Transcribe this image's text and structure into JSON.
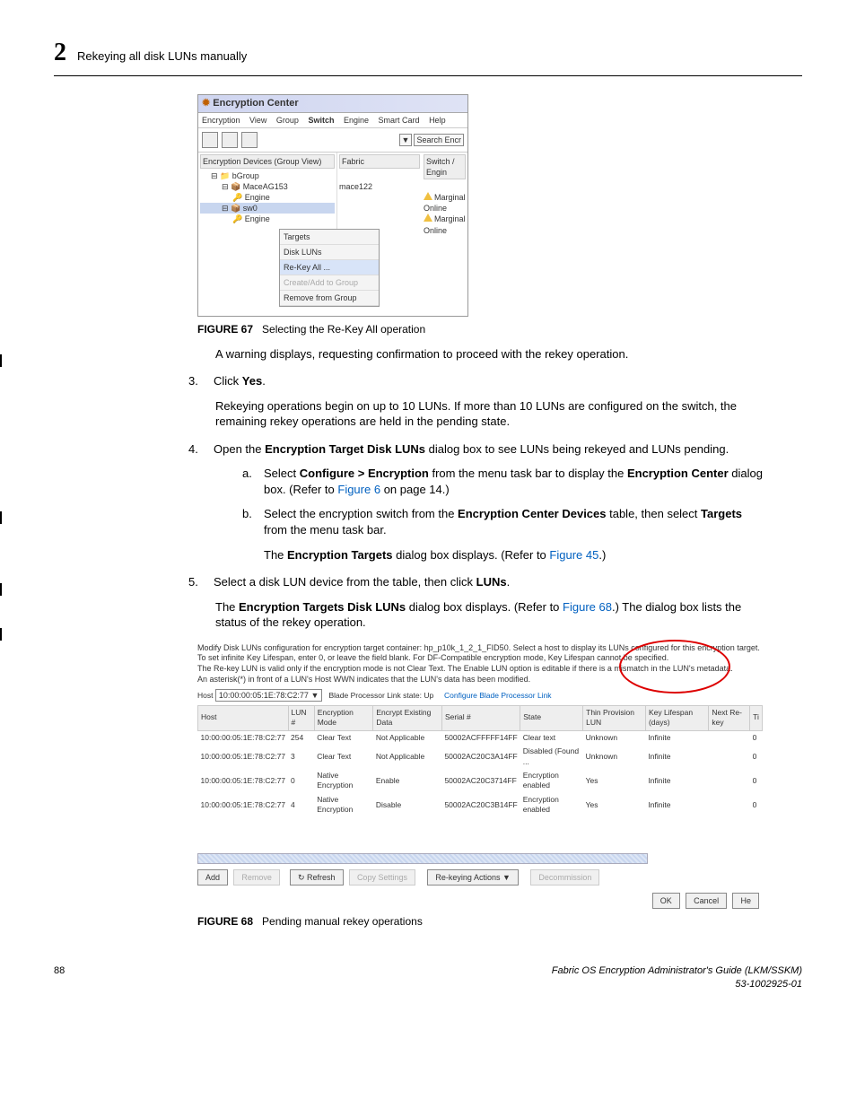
{
  "header": {
    "chapter_no": "2",
    "chapter_title": "Rekeying all disk LUNs manually"
  },
  "fig67": {
    "label": "FIGURE 67",
    "caption": "Selecting the Re-Key All operation",
    "window_title": "Encryption Center",
    "menus": [
      "Encryption",
      "View",
      "Group",
      "Switch",
      "Engine",
      "Smart Card",
      "Help"
    ],
    "search_placeholder": "Search Encr",
    "col1_head": "Encryption Devices (Group View)",
    "col2_head": "Fabric",
    "col3_head": "Switch / Engin",
    "tree": {
      "root": "bGroup",
      "n1": "MaceAG153",
      "n1_fab": "mace122",
      "n1_stat": "Marginal",
      "n1c": "Engine",
      "n1c_stat": "Online",
      "n2": "sw0",
      "n2_stat": "Marginal",
      "n2c": "Engine",
      "n2c_stat": "Online"
    },
    "ctx": [
      "Targets",
      "Disk LUNs",
      "Re-Key All ...",
      "Create/Add to Group",
      "Remove from Group"
    ]
  },
  "para_warning": "A warning displays, requesting confirmation to proceed with the rekey operation.",
  "step3": {
    "num": "3.",
    "pre": "Click ",
    "bold": "Yes",
    "post": "."
  },
  "para_rekey": "Rekeying operations begin on up to 10 LUNs. If more than 10 LUNs are configured on the switch, the remaining rekey operations are held in the pending state.",
  "step4": {
    "num": "4.",
    "pre": "Open the ",
    "bold": "Encryption Target Disk LUNs",
    "post": " dialog box to see LUNs being rekeyed and LUNs pending."
  },
  "sub_a": {
    "let": "a.",
    "p1": "Select ",
    "b1": "Configure > Encryption",
    "p2": " from the menu task bar to display the ",
    "b2": "Encryption Center",
    "p3": " dialog box. (Refer to ",
    "link": "Figure 6",
    "p4": " on page 14.)"
  },
  "sub_b": {
    "let": "b.",
    "p1": "Select the encryption switch from the ",
    "b1": "Encryption Center Devices",
    "p2": " table, then select ",
    "b2": "Targets",
    "p3": " from the menu task bar."
  },
  "para_targets": {
    "p1": "The ",
    "b1": "Encryption Targets",
    "p2": " dialog box displays. (Refer to ",
    "link": "Figure 45",
    "p3": ".)"
  },
  "step5": {
    "num": "5.",
    "p1": "Select a disk LUN device from the table, then click ",
    "b1": "LUNs",
    "p2": "."
  },
  "para_dlg": {
    "p1": "The ",
    "b1": "Encryption Targets Disk LUNs",
    "p2": " dialog box displays. (Refer to ",
    "link": "Figure 68",
    "p3": ".) The dialog box lists the status of the rekey operation."
  },
  "fig68": {
    "label": "FIGURE 68",
    "caption": "Pending manual rekey operations",
    "desc1": "Modify Disk LUNs configuration for encryption target container: hp_p10k_1_2_1_FID50. Select a host to display its LUNs configured for this encryption target.",
    "desc2": "To set infinite Key Lifespan, enter 0, or leave the field blank. For DF-Compatible encryption mode, Key Lifespan cannot be specified.",
    "desc3": "The Re-key LUN is valid only if the encryption mode is not Clear Text. The Enable LUN option is editable if there is a mismatch in the LUN's metadata.",
    "desc4": "An asterisk(*) in front of a LUN's Host WWN indicates that the LUN's data has been modified.",
    "host_label": "Host",
    "host_value": "10:00:00:05:1E:78:C2:77",
    "bpl_label": "Blade Processor Link state:",
    "bpl_value": "Up",
    "bpl_link": "Configure Blade Processor Link",
    "cols": [
      "Host",
      "LUN #",
      "Encryption Mode",
      "Encrypt Existing Data",
      "Serial #",
      "State",
      "Thin Provision LUN",
      "Key Lifespan (days)",
      "Next Re-key",
      "Ti"
    ],
    "rows": [
      [
        "10:00:00:05:1E:78:C2:77",
        "254",
        "Clear Text",
        "Not Applicable",
        "50002ACFFFFF14FF",
        "Clear text",
        "Unknown",
        "Infinite",
        "",
        "0"
      ],
      [
        "10:00:00:05:1E:78:C2:77",
        "3",
        "Clear Text",
        "Not Applicable",
        "50002AC20C3A14FF",
        "Disabled (Found ...",
        "Unknown",
        "Infinite",
        "",
        "0"
      ],
      [
        "10:00:00:05:1E:78:C2:77",
        "0",
        "Native Encryption",
        "Enable",
        "50002AC20C3714FF",
        "Encryption enabled",
        "Yes",
        "Infinite",
        "",
        "0"
      ],
      [
        "10:00:00:05:1E:78:C2:77",
        "4",
        "Native Encryption",
        "Disable",
        "50002AC20C3B14FF",
        "Encryption enabled",
        "Yes",
        "Infinite",
        "",
        "0"
      ]
    ],
    "btns": {
      "add": "Add",
      "remove": "Remove",
      "refresh": "Refresh",
      "copy": "Copy Settings",
      "rekey": "Re-keying Actions ▼",
      "decom": "Decommission",
      "ok": "OK",
      "cancel": "Cancel",
      "help": "He"
    }
  },
  "footer": {
    "page": "88",
    "line1": "Fabric OS Encryption Administrator's Guide  (LKM/SSKM)",
    "line2": "53-1002925-01"
  }
}
